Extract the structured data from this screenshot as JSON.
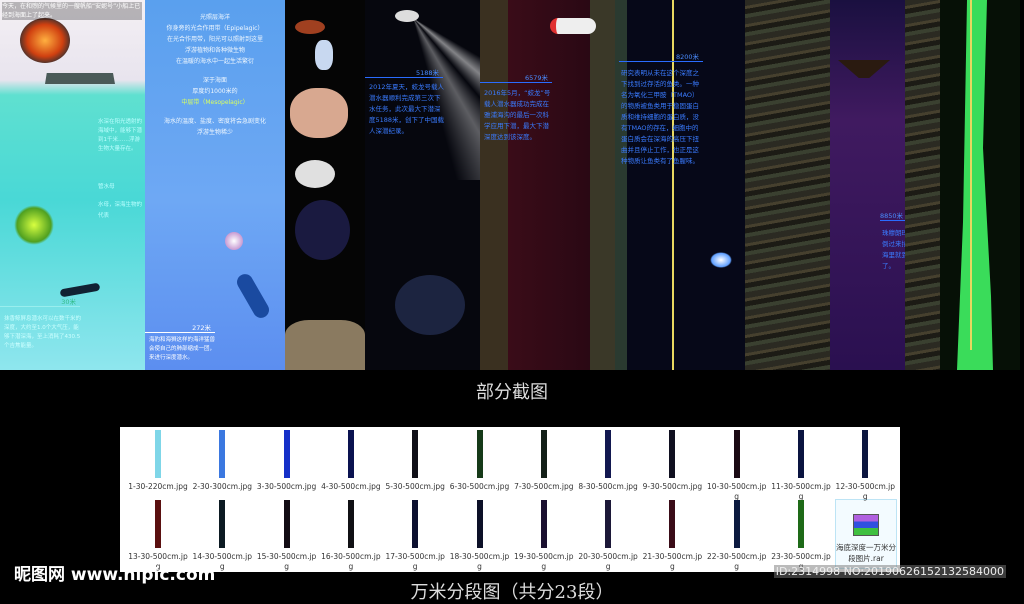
{
  "panels": {
    "p1": {
      "top_text": "今天，在和煦的气候里的一艘帆船“安妮号”小船上已经到海面上了起来。",
      "mid_text": "水深在阳光透射的海域中，能够下潜到1千米……浮游生物大量存在。",
      "label": "管水母",
      "label2": "水母，深海生物的代表",
      "depth": "30米",
      "bottom_text": "抹香鲸屏息潜水可以在数千米的深度，大约至1.0个大气压，能够下潜深海，至上消耗了430.5个吉焦能量。"
    },
    "p2": {
      "lines": [
        "光照层海洋",
        "你身旁的光合作用带（Epipelagic）",
        "在光合作用带，阳光可以照射到这里",
        "浮游植物和各种微生物",
        "在温暖的海水中一起生活繁衍"
      ],
      "lines2": [
        "深于海面",
        "厚度约1000米的",
        "中层带（Mesopelagic）"
      ],
      "lines3": [
        "海水的温度、盐度、密度将会急剧变化",
        "浮游生物稀少"
      ],
      "depth": "272米",
      "bottom_text": "海豹和海狮这样的海洋猛兽会使自己的肺部缩成一团，来进行深度潜水。"
    },
    "p4": {
      "depth": "5188米",
      "text": "2012年夏天，蛟龙号载人潜水器顺利完成第三次下水任务，此次最大下潜深度5188米，创下了中国载人深潜纪录。"
    },
    "p5": {
      "depth": "6579米",
      "text": "2016年5月，“蛟龙”号载人潜水器成功完成在雅浦海沟的最后一次科学应用下潜，最大下潜深度达到该深度。"
    },
    "p6": {
      "depth": "8200米",
      "text": "研究表明从未在这个深度之下找到过存活的鱼类。一种名为氧化三甲胺（TMAO）的物质被鱼类用于稳固蛋白质和维持细胞的蛋白质，没有TMAO的存在，细胞中的蛋白质会在深海的高压下扭曲并且停止工作，也正是这种物质让鱼类有了鱼腥味。"
    },
    "p8": {
      "depth": "8850米",
      "text": "珠穆朗玛峰倒过来插在海里就到这了。"
    }
  },
  "caption": "部分截图",
  "files": [
    {
      "name": "1-30-220cm.jpg",
      "color": "#7fd6e8"
    },
    {
      "name": "2-30-300cm.jpg",
      "color": "#3b78e0"
    },
    {
      "name": "3-30-500cm.jpg",
      "color": "#1530c8"
    },
    {
      "name": "4-30-500cm.jpg",
      "color": "#0a1250"
    },
    {
      "name": "5-30-500cm.jpg",
      "color": "#101018"
    },
    {
      "name": "6-30-500cm.jpg",
      "color": "#163a18"
    },
    {
      "name": "7-30-500cm.jpg",
      "color": "#142018"
    },
    {
      "name": "8-30-500cm.jpg",
      "color": "#121850"
    },
    {
      "name": "9-30-500cm.jpg",
      "color": "#101020"
    },
    {
      "name": "10-30-500cm.jpg",
      "color": "#1a0a14"
    },
    {
      "name": "11-30-500cm.jpg",
      "color": "#0a1440"
    },
    {
      "name": "12-30-500cm.jpg",
      "color": "#0c1640"
    },
    {
      "name": "13-30-500cm.jpg",
      "color": "#5a1010"
    },
    {
      "name": "14-30-500cm.jpg",
      "color": "#0c1a22"
    },
    {
      "name": "15-30-500cm.jpg",
      "color": "#120c14"
    },
    {
      "name": "16-30-500cm.jpg",
      "color": "#101014"
    },
    {
      "name": "17-30-500cm.jpg",
      "color": "#0c1030"
    },
    {
      "name": "18-30-500cm.jpg",
      "color": "#0c1028"
    },
    {
      "name": "19-30-500cm.jpg",
      "color": "#1a1030"
    },
    {
      "name": "20-30-500cm.jpg",
      "color": "#1c1838"
    },
    {
      "name": "21-30-500cm.jpg",
      "color": "#3a0c18"
    },
    {
      "name": "22-30-500cm.jpg",
      "color": "#0c1a40"
    },
    {
      "name": "23-30-500cm.jpg",
      "color": "#1e6a18"
    }
  ],
  "rar_name": "海底深度一万米分段图片.rar",
  "watermark": "昵图网 www.nipic.com",
  "id_text": "ID:2314998 NO:20190626152132584000",
  "bottom_caption": "万米分段图（共分23段）"
}
